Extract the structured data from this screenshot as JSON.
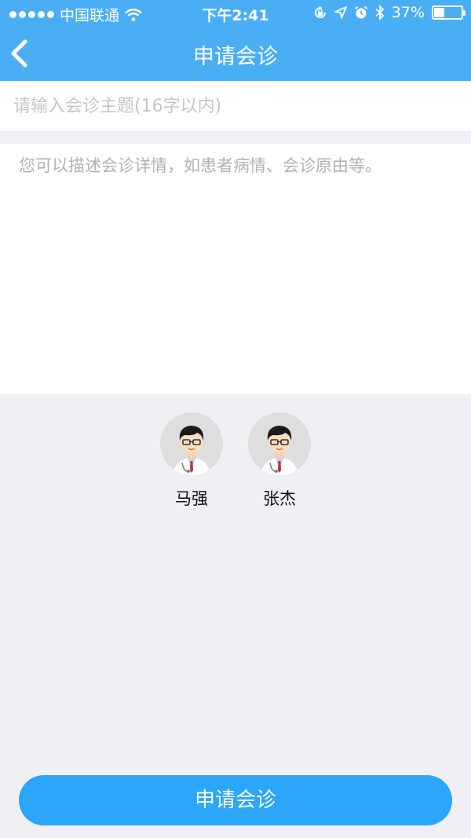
{
  "status_bar": {
    "carrier": "中国联通",
    "time": "下午2:41",
    "battery": "37%",
    "battery_level": 0.37
  },
  "nav": {
    "title": "申请会诊"
  },
  "form": {
    "subject_placeholder": "请输入会诊主题(16字以内)",
    "description_placeholder": "您可以描述会诊详情，如患者病情、会诊原由等。"
  },
  "doctors": [
    {
      "name": "马强"
    },
    {
      "name": "张杰"
    }
  ],
  "submit_label": "申请会诊",
  "colors": {
    "header": "#4aaef5",
    "button": "#2ba6f8",
    "background": "#efeff4"
  }
}
